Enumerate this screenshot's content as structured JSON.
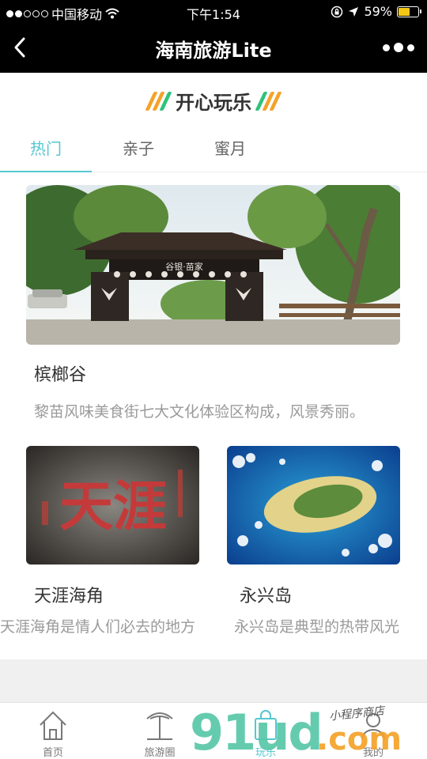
{
  "status_bar": {
    "carrier": "中国移动",
    "time": "下午1:54",
    "battery": "59%",
    "battery_level": 0.59,
    "signal_bars": 2
  },
  "nav": {
    "title": "海南旅游Lite",
    "back_icon": "chevron-left-icon",
    "more_icon": "more-dots-icon"
  },
  "section": {
    "heading": "开心玩乐",
    "stripe_colors": [
      "#f4a229",
      "#f4a229",
      "#2ec37a"
    ]
  },
  "tabs": [
    {
      "label": "热门",
      "active": true
    },
    {
      "label": "亲子",
      "active": false
    },
    {
      "label": "蜜月",
      "active": false
    }
  ],
  "featured": {
    "title": "槟榔谷",
    "desc": "黎苗风味美食街七大文化体验区构成，风景秀丽。",
    "gate_sign": "谷银·苗家"
  },
  "cards": [
    {
      "title": "天涯海角",
      "desc": "天涯海角是情人们必去的地方",
      "stone_text": "天涯"
    },
    {
      "title": "永兴岛",
      "desc": "永兴岛是典型的热带风光"
    }
  ],
  "tabbar": [
    {
      "label": "首页",
      "icon": "home-icon"
    },
    {
      "label": "旅游圈",
      "icon": "palm-tree-icon"
    },
    {
      "label": "玩乐",
      "icon": "shopping-bag-icon",
      "active": true
    },
    {
      "label": "我的",
      "icon": "user-icon"
    }
  ],
  "watermark": {
    "brand": "91ud",
    "suffix": ".com",
    "tagline": "小程序商店"
  },
  "colors": {
    "accent": "#55c7cf",
    "header_bg": "#000000"
  }
}
